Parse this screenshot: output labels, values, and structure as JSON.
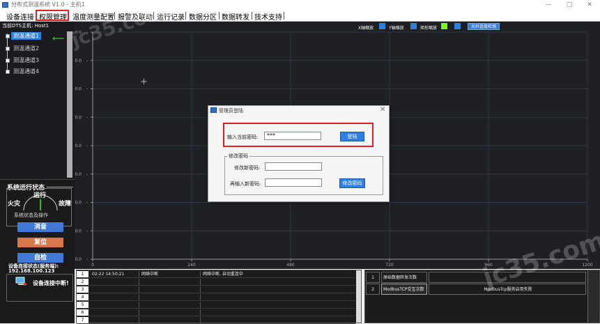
{
  "window": {
    "title": "分布式测温系统 V1.0 - 主机1",
    "minimize": "—",
    "maximize": "□",
    "close": "✕"
  },
  "menu": [
    {
      "label": "设备连接"
    },
    {
      "label": "权限管理"
    },
    {
      "label": "温度测量配置"
    },
    {
      "label": "报警及联动"
    },
    {
      "label": "运行记录"
    },
    {
      "label": "数据分区"
    },
    {
      "label": "数据转发"
    },
    {
      "label": "技术支持"
    }
  ],
  "left_panel": {
    "host_label": "当前DTS主机: Host1",
    "channels": [
      {
        "label": "测温通道1",
        "selected": true
      },
      {
        "label": "测温通道2",
        "selected": false
      },
      {
        "label": "测温通道3",
        "selected": false
      },
      {
        "label": "测温通道4",
        "selected": false
      }
    ],
    "arrow": "⟵"
  },
  "status_panel": {
    "title": "系统运行状态",
    "gauge_run": "运行",
    "gauge_fire": "火灾",
    "gauge_fault": "故障",
    "ops_label": "系统状态及操作",
    "btn_mute": "消音",
    "btn_reset": "复位",
    "btn_selftest": "自检",
    "colors": {
      "mute": "#3f78d6",
      "reset": "#d9774a",
      "selftest": "#3f78d6"
    }
  },
  "connection": {
    "label": "设备连接状态(服务端):",
    "ip": "192.168.100.123",
    "status": "设备连接中断!"
  },
  "chart_toolbar": {
    "x_zoom": "X轴缩放",
    "y_zoom": "Y轴缩放",
    "rect_zoom": "矩形缩放",
    "fiber_detect": "光纤连接检测",
    "swatch_colors": [
      "#2d7fe0",
      "#2d7fe0",
      "#2d7fe0",
      "#7dfc1a",
      "#2d7fe0"
    ]
  },
  "chart_data": {
    "type": "line",
    "yticks": [
      "0.0",
      "10.0",
      "20.0",
      "30.0",
      "40.0",
      "50.0",
      "60.0",
      "70.0",
      "80.0"
    ],
    "xticks": [
      "0",
      "240",
      "480",
      "720",
      "960",
      "1200"
    ],
    "ylim": [
      0,
      80
    ],
    "xlim": [
      0,
      1200
    ],
    "series": [],
    "grid": true
  },
  "log_table": {
    "rows": [
      {
        "idx": "1",
        "time": "02-22  14:50:21",
        "event": "网络中断",
        "detail": "网络中断, 自动重连中"
      },
      {
        "idx": "2",
        "time": "",
        "event": "",
        "detail": ""
      },
      {
        "idx": "3",
        "time": "",
        "event": "",
        "detail": ""
      },
      {
        "idx": "4",
        "time": "",
        "event": "",
        "detail": ""
      },
      {
        "idx": "5",
        "time": "",
        "event": "",
        "detail": ""
      },
      {
        "idx": "6",
        "time": "",
        "event": "",
        "detail": ""
      },
      {
        "idx": "7",
        "time": "",
        "event": "",
        "detail": ""
      }
    ]
  },
  "forward_table": {
    "rows": [
      {
        "idx": "1",
        "name": "原始数据转发次数",
        "value": ""
      },
      {
        "idx": "2",
        "name": "ModbusTCP交互次数",
        "value": "ModbusTcp服务启用失败"
      }
    ]
  },
  "dialog": {
    "title": "管理员登陆",
    "close": "✕",
    "current_pwd_label": "输入当前密码:",
    "current_pwd_value": "***",
    "login_btn": "登陆",
    "change_group": "修改密码",
    "new_pwd_label": "修改新密码:",
    "confirm_pwd_label": "再输入新密码:",
    "change_btn": "修改密码"
  },
  "watermark": "jc35.com"
}
